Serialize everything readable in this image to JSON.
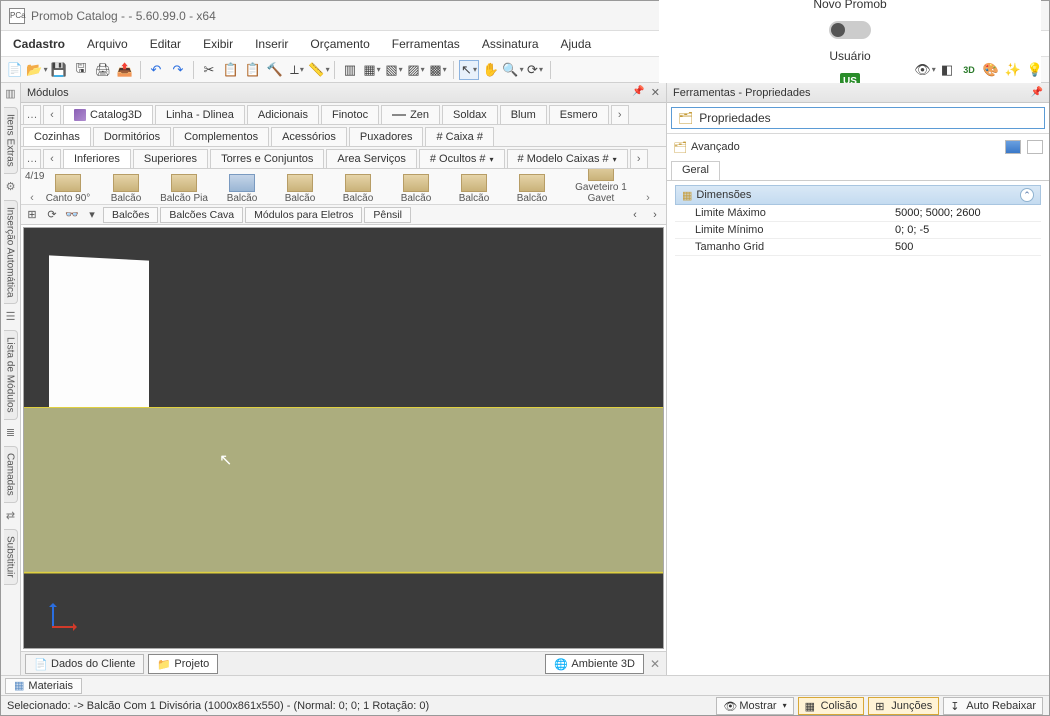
{
  "title": "Promob Catalog -        - 5.60.99.0 - x64",
  "app_icon_text": "PCa",
  "menu": [
    "Cadastro",
    "Arquivo",
    "Editar",
    "Exibir",
    "Inserir",
    "Orçamento",
    "Ferramentas",
    "Assinatura",
    "Ajuda"
  ],
  "novo_promob": "Novo Promob",
  "usuario_label": "Usuário",
  "usuario_badge": "US",
  "left_rail": [
    "Itens Extras",
    "Inserção Automática",
    "Lista de Módulos",
    "Camadas",
    "Substituir"
  ],
  "modulos_header": "Módulos",
  "tabstrip1": [
    "Catalog3D",
    "Linha - Dlinea",
    "Adicionais",
    "Finotoc",
    "Zen",
    "Soldax",
    "Blum",
    "Esmero"
  ],
  "tabstrip2": [
    "Cozinhas",
    "Dormitórios",
    "Complementos",
    "Acessórios",
    "Puxadores",
    "# Caixa #"
  ],
  "tabstrip3": [
    "Inferiores",
    "Superiores",
    "Torres e Conjuntos",
    "Area Serviços",
    "# Ocultos #",
    "# Modelo Caixas #"
  ],
  "page_indicator": "4/19",
  "gallery": [
    "Canto 90°",
    "Balcão",
    "Balcão Pia",
    "Balcão",
    "Balcão",
    "Balcão",
    "Balcão",
    "Balcão",
    "Balcão",
    "Gaveteiro 1 Gavet"
  ],
  "filters": [
    "Balcões",
    "Balcões Cava",
    "Módulos para Eletros",
    "Pênsil"
  ],
  "bottom_tabs": {
    "dados": "Dados do Cliente",
    "projeto": "Projeto",
    "ambiente": "Ambiente 3D"
  },
  "right_panel_header": "Ferramentas - Propriedades",
  "props_label": "Propriedades",
  "avancado": "Avançado",
  "geral_tab": "Geral",
  "dim_group": "Dimensões",
  "props": {
    "limite_max_k": "Limite Máximo",
    "limite_max_v": "5000; 5000; 2600",
    "limite_min_k": "Limite Mínimo",
    "limite_min_v": "0; 0; -5",
    "tamanho_grid_k": "Tamanho Grid",
    "tamanho_grid_v": "500"
  },
  "materiais_tab": "Materiais",
  "status_text": "Selecionado:   -> Balcão Com 1 Divisória (1000x861x550) - (Normal: 0; 0; 1 Rotação: 0)",
  "status_buttons": {
    "mostrar": "Mostrar",
    "colisao": "Colisão",
    "juncoes": "Junções",
    "auto": "Auto Rebaixar"
  }
}
